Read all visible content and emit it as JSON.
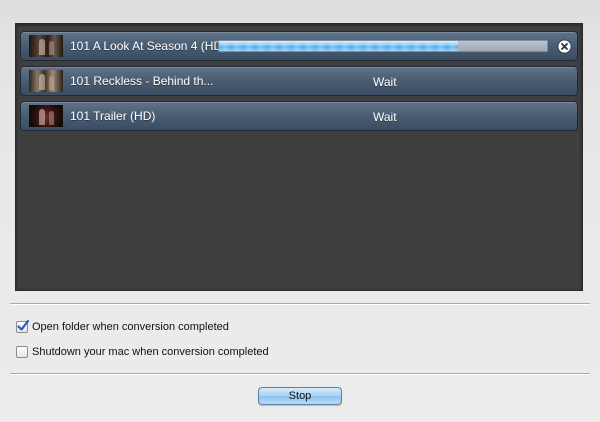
{
  "queue": {
    "items": [
      {
        "title": "101 A Look At Season 4 (HD)",
        "status": "",
        "progress": 0.73,
        "thumbnail": "video-thumbnail"
      },
      {
        "title": "101 Reckless - Behind th...",
        "status": "Wait",
        "thumbnail": "video-thumbnail"
      },
      {
        "title": "101 Trailer (HD)",
        "status": "Wait",
        "thumbnail": "video-thumbnail"
      }
    ],
    "cancel_icon": "close-circle-icon"
  },
  "options": {
    "open_folder": {
      "label": "Open folder when conversion completed",
      "checked": true
    },
    "shutdown": {
      "label": "Shutdown your mac when conversion completed",
      "checked": false
    }
  },
  "actions": {
    "stop_label": "Stop"
  },
  "colors": {
    "panel_bg": "#3f3f3f",
    "row_bg": "#485c72",
    "progress_fill": "#52a8e6",
    "check_mark": "#1f5fbf"
  }
}
